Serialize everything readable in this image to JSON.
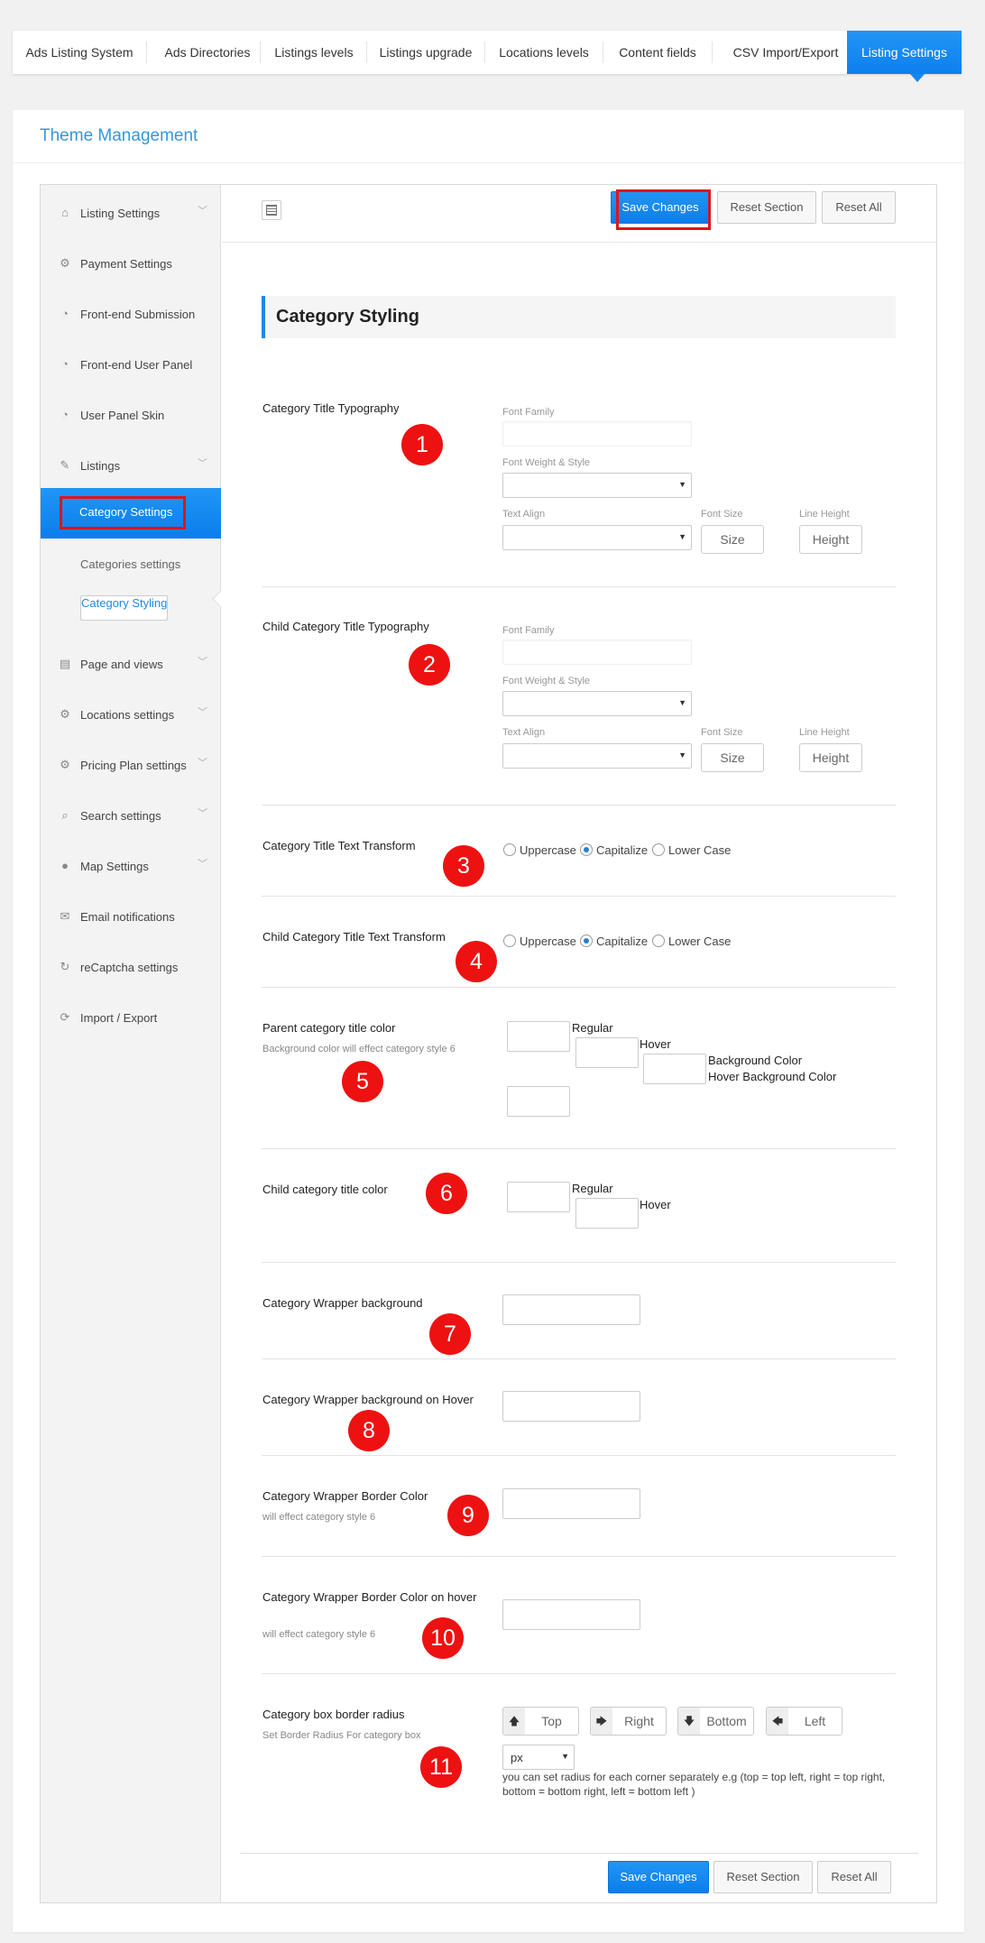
{
  "nav": {
    "tabs": [
      "Ads Listing System",
      "Ads Directories",
      "Listings levels",
      "Listings upgrade",
      "Locations levels",
      "Content fields",
      "CSV Import/Export",
      "Listing Settings"
    ]
  },
  "panel": {
    "title": "Theme Management"
  },
  "sidebar": {
    "items": [
      {
        "label": "Listing Settings",
        "icon": "home-icon"
      },
      {
        "label": "Payment Settings",
        "icon": "gear-icon"
      },
      {
        "label": "Front-end Submission",
        "icon": "dashboard-icon"
      },
      {
        "label": "Front-end User Panel",
        "icon": "dashboard-icon"
      },
      {
        "label": "User Panel Skin",
        "icon": "dashboard-icon"
      },
      {
        "label": "Listings",
        "icon": "edit-icon"
      },
      {
        "label": "Page and views",
        "icon": "page-icon"
      },
      {
        "label": "Locations settings",
        "icon": "gear-icon"
      },
      {
        "label": "Pricing Plan settings",
        "icon": "gear-icon"
      },
      {
        "label": "Search settings",
        "icon": "search-icon"
      },
      {
        "label": "Map Settings",
        "icon": "pin-icon"
      },
      {
        "label": "Email notifications",
        "icon": "mail-icon"
      },
      {
        "label": "reCaptcha settings",
        "icon": "refresh-icon"
      },
      {
        "label": "Import / Export",
        "icon": "sync-icon"
      }
    ],
    "active": "Category Settings",
    "sub": [
      "Categories settings",
      "Category Styling"
    ]
  },
  "toolbar": {
    "save": "Save Changes",
    "reset_section": "Reset Section",
    "reset_all": "Reset All"
  },
  "section": {
    "title": "Category Styling"
  },
  "typo": {
    "font_family": "Font Family",
    "weight_style": "Font Weight & Style",
    "text_align": "Text Align",
    "font_size": "Font Size",
    "line_height": "Line Height",
    "size_ph": "Size",
    "height_ph": "Height"
  },
  "rows": {
    "cat_title_typo": "Category Title Typography",
    "child_title_typo": "Child Category Title Typography",
    "cat_transform": "Category Title Text Transform",
    "child_transform": "Child Category Title Text Transform",
    "parent_color": "Parent category title color",
    "parent_color_desc": "Background color will effect category style 6",
    "child_color": "Child category title color",
    "wrapper_bg": "Category Wrapper background",
    "wrapper_bg_hover": "Category Wrapper background on Hover",
    "wrapper_border": "Category Wrapper Border Color",
    "wrapper_border_desc": "will effect category style 6",
    "wrapper_border_hover": "Category Wrapper Border Color on hover",
    "wrapper_border_hover_desc": "will effect category style 6",
    "radius": "Category box border radius",
    "radius_desc": "Set Border Radius For category box"
  },
  "transform_opts": [
    "Uppercase",
    "Capitalize",
    "Lower Case"
  ],
  "color_labels": {
    "regular": "Regular",
    "hover": "Hover",
    "bg": "Background Color",
    "hover_bg": "Hover Background Color"
  },
  "radius": {
    "top": "Top",
    "right": "Right",
    "bottom": "Bottom",
    "left": "Left",
    "unit": "px",
    "note": "you can set radius for each corner separately e.g (top = top left, right = top right, bottom = bottom right, left = bottom left )"
  },
  "badges": [
    "1",
    "2",
    "3",
    "4",
    "5",
    "6",
    "7",
    "8",
    "9",
    "10",
    "11"
  ]
}
